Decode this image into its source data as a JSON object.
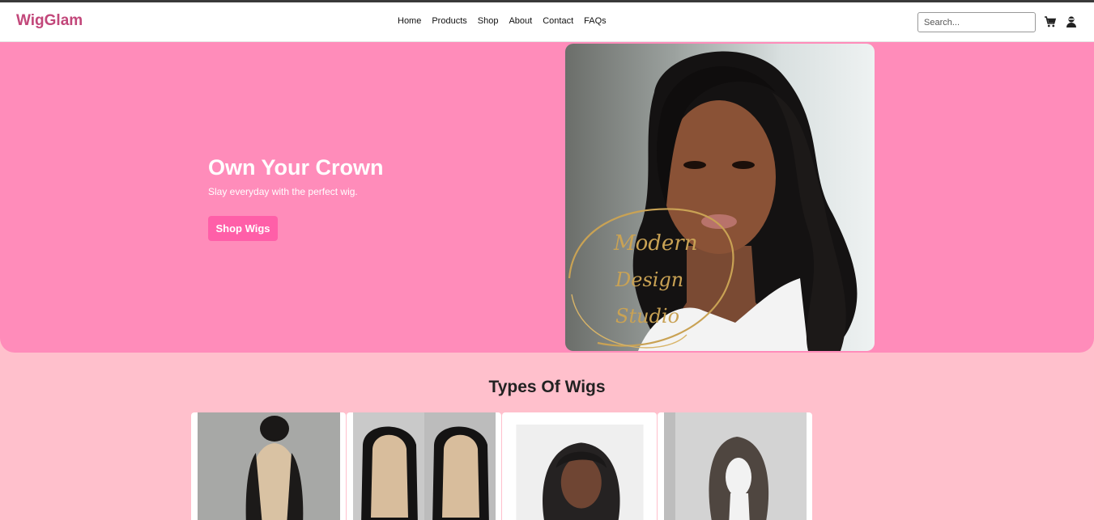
{
  "header": {
    "logo": "WigGlam",
    "nav": [
      {
        "label": "Home"
      },
      {
        "label": "Products"
      },
      {
        "label": "Shop"
      },
      {
        "label": "About"
      },
      {
        "label": "Contact"
      },
      {
        "label": "FAQs"
      }
    ],
    "search_placeholder": "Search...",
    "icons": [
      "cart-icon",
      "user-icon"
    ]
  },
  "hero": {
    "title": "Own Your Crown",
    "subtitle": "Slay everyday with the perfect wig.",
    "cta_label": "Shop Wigs",
    "image_watermark": "Modern Design Studio"
  },
  "types_section": {
    "title": "Types Of Wigs"
  },
  "colors": {
    "brand": "#c2477a",
    "hero_bg": "#ff8cba",
    "cta_bg": "#ff5fa8",
    "page_bg": "#ffc0cc"
  }
}
